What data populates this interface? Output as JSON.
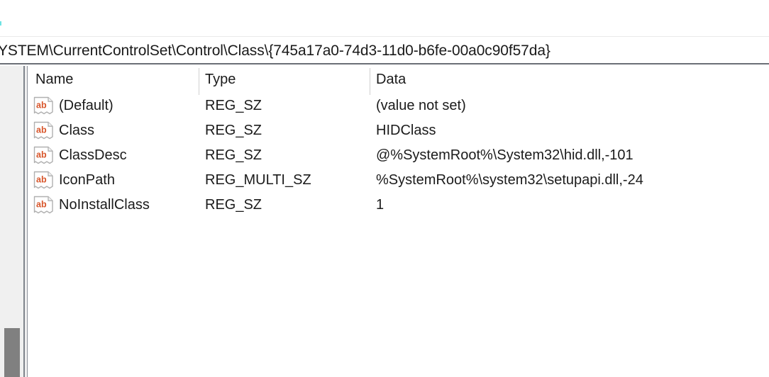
{
  "window": {
    "title_bar_empty": ""
  },
  "address_bar": {
    "path": "YSTEM\\CurrentControlSet\\Control\\Class\\{745a17a0-74d3-11d0-b6fe-00a0c90f57da}",
    "full_path_note": "YSTEM\\CurrentControlSet\\Control\\Class\\{745a17a0-74d3-11d0-b6fe-00a0c90f57da}"
  },
  "list": {
    "columns": [
      {
        "key": "name",
        "label": "Name"
      },
      {
        "key": "type",
        "label": "Type"
      },
      {
        "key": "data",
        "label": "Data"
      }
    ],
    "rows": [
      {
        "icon": "string-value-ab-icon",
        "name": "(Default)",
        "type": "REG_SZ",
        "data": "(value not set)"
      },
      {
        "icon": "string-value-ab-icon",
        "name": "Class",
        "type": "REG_SZ",
        "data": "HIDClass"
      },
      {
        "icon": "string-value-ab-icon",
        "name": "ClassDesc",
        "type": "REG_SZ",
        "data": "@%SystemRoot%\\System32\\hid.dll,-101"
      },
      {
        "icon": "string-value-ab-icon",
        "name": "IconPath",
        "type": "REG_MULTI_SZ",
        "data": "%SystemRoot%\\system32\\setupapi.dll,-24"
      },
      {
        "icon": "string-value-ab-icon",
        "name": "NoInstallClass",
        "type": "REG_SZ",
        "data": "1"
      }
    ]
  },
  "icons": {
    "ab_label": "ab"
  },
  "colors": {
    "icon_text": "#d8552a",
    "icon_border": "#b0b0b0",
    "panel_bg": "#f0f0f0",
    "scrollbar_thumb": "#808080",
    "divider": "#7f848c",
    "text": "#1b1b1b",
    "column_divider": "#d0d0d0",
    "address_underline": "#6b6f76"
  },
  "scrollbar": {
    "orientation": "vertical",
    "position": "left"
  }
}
